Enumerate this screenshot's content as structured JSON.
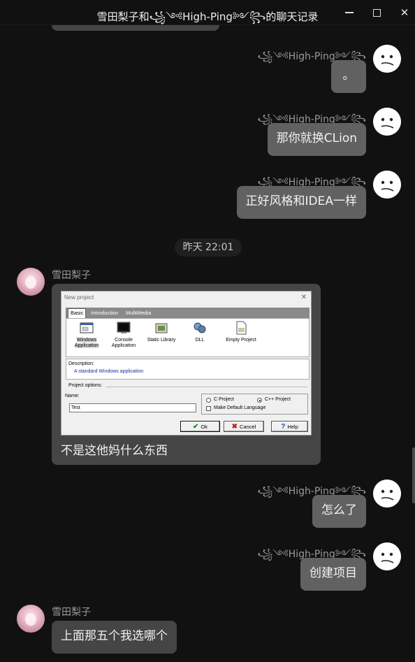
{
  "window": {
    "title": "雪田梨子和꧁༺High-Ping༻꧂的聊天记录"
  },
  "messages": [
    {
      "sender": "꧁༺High-Ping༻꧂",
      "text": "。"
    },
    {
      "sender": "꧁༺High-Ping༻꧂",
      "text": "那你就换CLion"
    },
    {
      "sender": "꧁༺High-Ping༻꧂",
      "text": "正好风格和IDEA一样"
    },
    {
      "time": "昨天 22:01"
    },
    {
      "sender": "雪田梨子",
      "caption": "不是这他妈什么东西"
    },
    {
      "sender": "꧁༺High-Ping༻꧂",
      "text": "怎么了"
    },
    {
      "sender": "꧁༺High-Ping༻꧂",
      "text": "创建项目"
    },
    {
      "sender": "雪田梨子",
      "text": "上面那五个我选哪个"
    }
  ],
  "dialog": {
    "title": "New project",
    "tabs": [
      "Basic",
      "Introduction",
      "MultiMedia"
    ],
    "projects": [
      {
        "label": "Windows Application",
        "icon": "window-icon"
      },
      {
        "label": "Console Application",
        "icon": "console-icon"
      },
      {
        "label": "Static Library",
        "icon": "library-icon"
      },
      {
        "label": "DLL",
        "icon": "dll-icon"
      },
      {
        "label": "Empty Project",
        "icon": "file-icon"
      }
    ],
    "description_label": "Description:",
    "description": "A standard Windows application",
    "options_label": "Project options:",
    "name_label": "Name:",
    "name_value": "Test",
    "c_project": "C Project",
    "cpp_project": "C++ Project",
    "default_lang": "Make Default Language",
    "ok": "Ok",
    "cancel": "Cancel",
    "help": "Help"
  },
  "colors": {
    "background": "#111111",
    "bubble_in": "#454545",
    "bubble_out": "#616161"
  }
}
